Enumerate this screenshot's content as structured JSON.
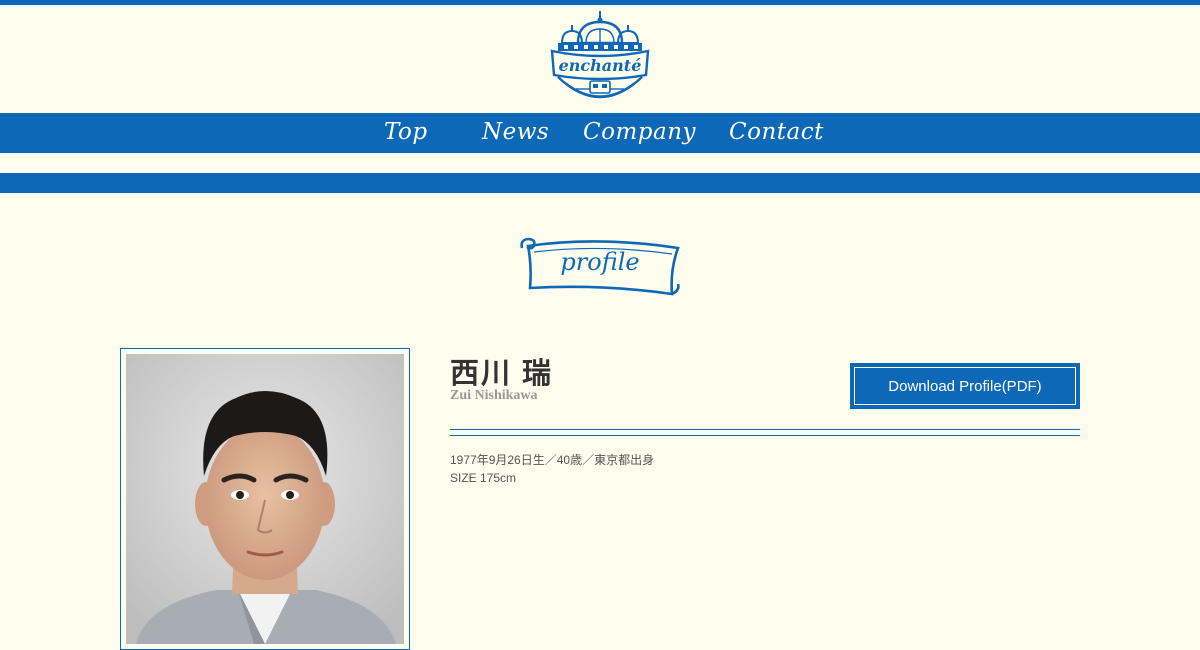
{
  "brand": {
    "logo_text": "enchanté"
  },
  "nav": {
    "items": [
      {
        "label": "Top"
      },
      {
        "label": "News"
      },
      {
        "label": "Company"
      },
      {
        "label": "Contact"
      }
    ]
  },
  "section": {
    "title": "profile"
  },
  "profile": {
    "name_ja": "西川 瑞",
    "name_en": "Zui Nishikawa",
    "details": [
      "1977年9月26日生／40歳／東京都出身",
      "SIZE 175cm"
    ],
    "download_label": "Download Profile(PDF)"
  },
  "colors": {
    "brand_blue": "#0d68b8",
    "page_bg": "#fffeee",
    "heading_text": "#333333",
    "subtext": "#999999"
  }
}
